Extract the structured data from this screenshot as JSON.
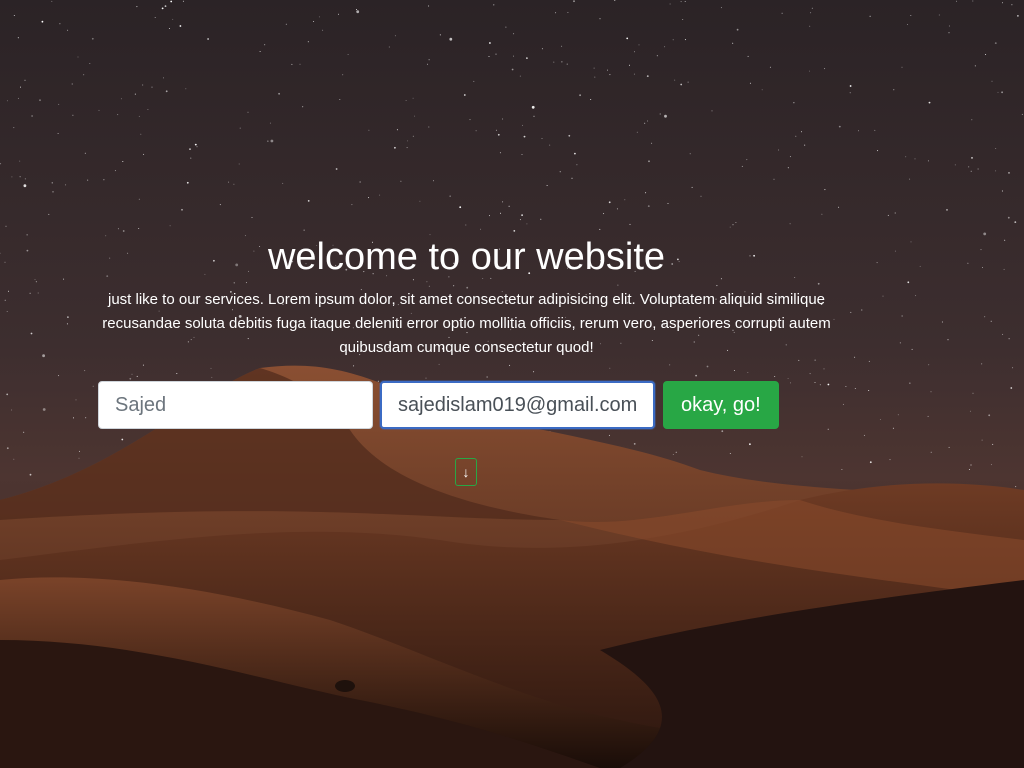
{
  "hero": {
    "title": "welcome to our website",
    "subtitle": "just like to our services. Lorem ipsum dolor, sit amet consectetur adipisicing elit. Voluptatem aliquid similique recusandae soluta debitis fuga itaque deleniti error optio mollitia officiis, rerum vero, asperiores corrupti autem quibusdam cumque consectetur quod!"
  },
  "form": {
    "name_placeholder": "Sajed",
    "email_value": "sajedislam019@gmail.com",
    "submit_label": "okay, go!"
  },
  "scroll": {
    "icon": "arrow-down-icon",
    "glyph": "↓"
  },
  "colors": {
    "accent": "#28a745",
    "focus": "#3b6bc4",
    "text": "#ffffff"
  }
}
